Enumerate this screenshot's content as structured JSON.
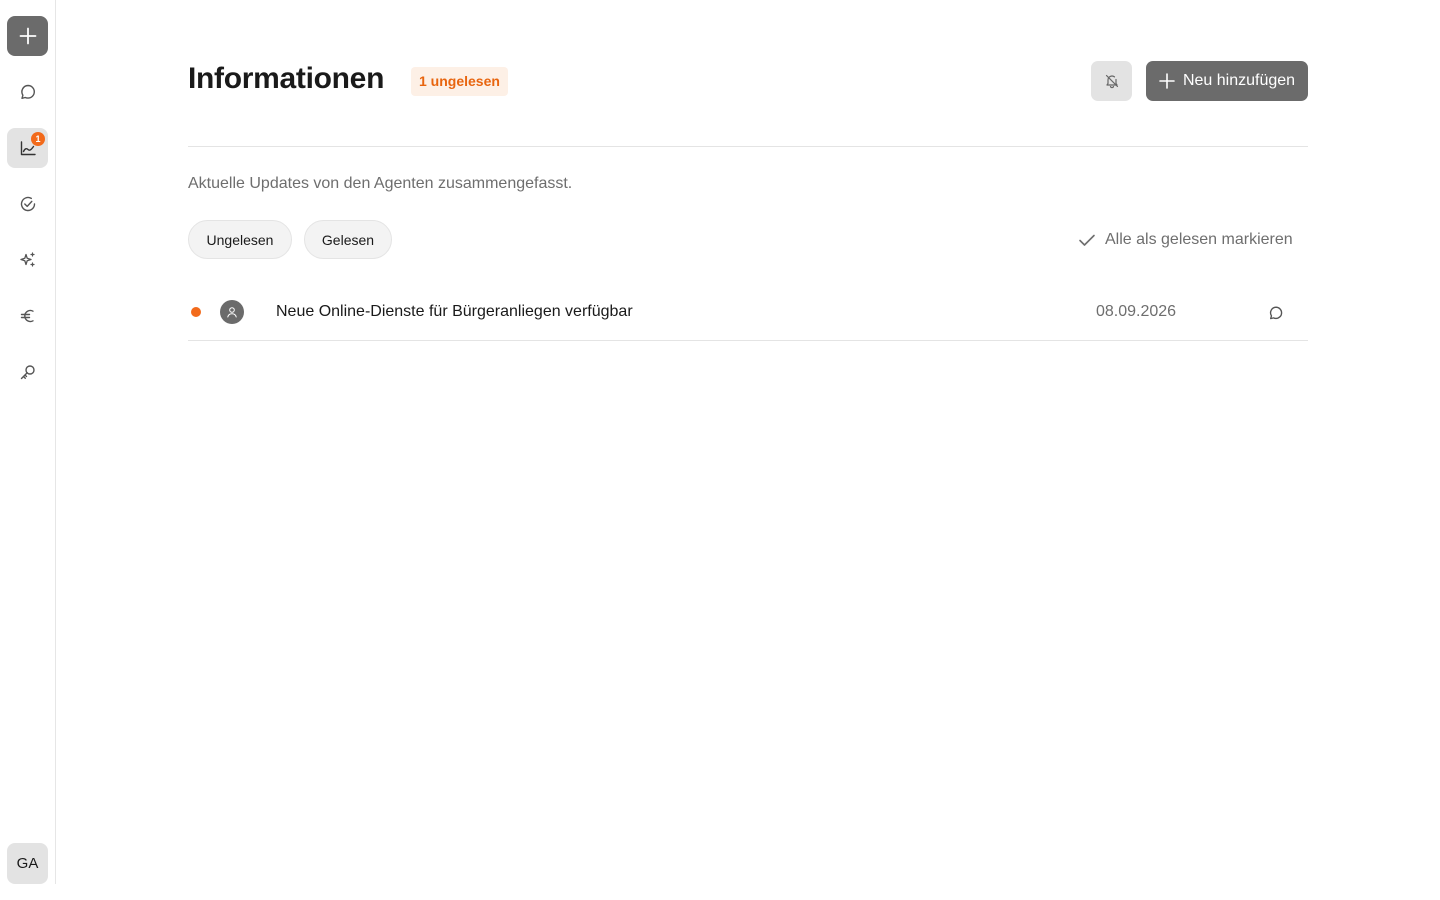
{
  "sidebar": {
    "new_button": "plus-icon",
    "items": [
      {
        "name": "chat",
        "icon": "chat-bubble-icon"
      },
      {
        "name": "informationen",
        "icon": "chart-line-icon",
        "badge": "1",
        "active": true
      },
      {
        "name": "tasks",
        "icon": "check-circle-icon"
      },
      {
        "name": "agents",
        "icon": "sparkles-icon"
      },
      {
        "name": "costs",
        "icon": "euro-icon"
      },
      {
        "name": "keys",
        "icon": "key-icon"
      }
    ],
    "avatar_initials": "GA"
  },
  "header": {
    "title": "Informationen",
    "unread_badge": "1 ungelesen",
    "bell_icon": "bell-off-icon",
    "add_button_label": "Neu hinzufügen"
  },
  "subtitle": "Aktuelle Updates von den Agenten zusammengefasst.",
  "filters": {
    "unread_label": "Ungelesen",
    "read_label": "Gelesen"
  },
  "mark_all_label": "Alle als gelesen markieren",
  "items": [
    {
      "title": "Neue Online-Dienste für Bürgeranliegen verfügbar",
      "date": "08.09.2026",
      "unread": true
    }
  ],
  "colors": {
    "accent": "#f26a1b",
    "button": "#6b6b6b",
    "badge_bg": "#fdf0e6",
    "badge_text": "#e8650f"
  }
}
